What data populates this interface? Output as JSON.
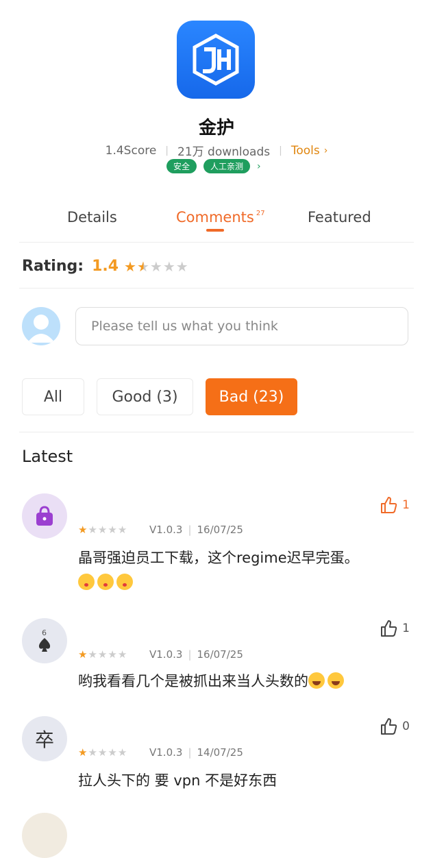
{
  "app": {
    "name": "金护",
    "score": "1.4Score",
    "downloads": "21万 downloads",
    "category": "Tools",
    "tags": [
      "安全",
      "人工亲测"
    ]
  },
  "tabs": [
    {
      "label": "Details"
    },
    {
      "label": "Comments",
      "count": "27"
    },
    {
      "label": "Featured"
    }
  ],
  "rating": {
    "label": "Rating:",
    "value": "1.4",
    "stars": 1.5
  },
  "comment_box": {
    "placeholder": "Please tell us what you think"
  },
  "filters": [
    {
      "label": "All"
    },
    {
      "label": "Good (3)"
    },
    {
      "label": "Bad (23)"
    }
  ],
  "latest_label": "Latest",
  "comments": [
    {
      "stars": 1,
      "version": "V1.0.3",
      "date": "16/07/25",
      "text": "晶哥强迫员工下载，这个regime迟早完蛋。",
      "likes": "1",
      "avatar": "handbag-icon"
    },
    {
      "stars": 1,
      "version": "V1.0.3",
      "date": "16/07/25",
      "text": "哟我看看几个是被抓出来当人头数的",
      "likes": "1",
      "avatar": "playing-card-spade-icon"
    },
    {
      "stars": 1,
      "version": "V1.0.3",
      "date": "14/07/25",
      "text": "拉人头下的 要 vpn 不是好东西",
      "likes": "0",
      "avatar_char": "卒"
    }
  ],
  "colors": {
    "accent": "#f06a28",
    "star": "#f39a22",
    "tag": "#1f9e5e",
    "brand_blue": "#1668ea"
  }
}
